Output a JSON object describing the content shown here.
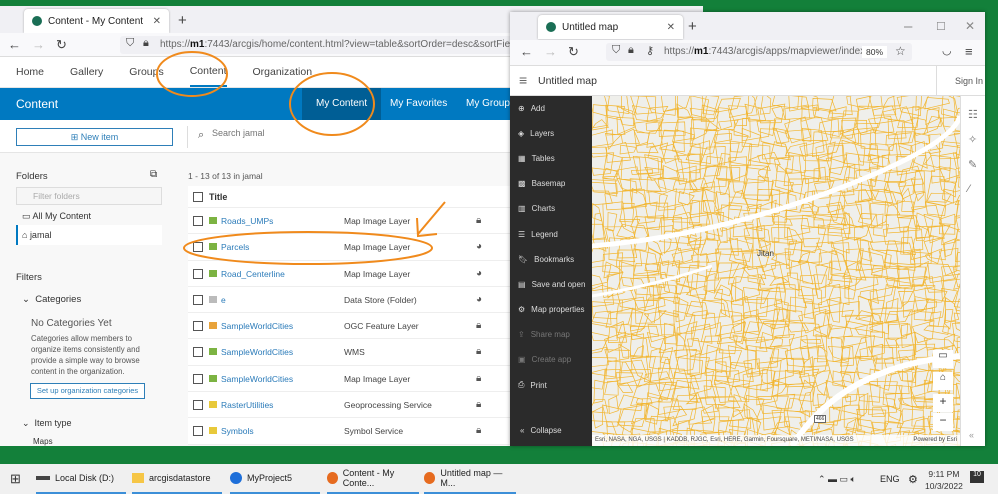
{
  "left_browser": {
    "tab_title": "Content - My Content",
    "url_prefix": "https://",
    "url_host": "m1",
    "url_rest": ":7443/arcgis/home/content.html?view=table&sortOrder=desc&sortField=mo",
    "nav": [
      "Home",
      "Gallery",
      "Groups",
      "Content",
      "Organization"
    ],
    "header_title": "Content",
    "subtabs": [
      "My Content",
      "My Favorites",
      "My Groups"
    ],
    "new_item": "New item",
    "search_placeholder": "Search jamal",
    "folders_label": "Folders",
    "filter_placeholder": "Filter folders",
    "folders": [
      "All My Content",
      "jamal"
    ],
    "filters_label": "Filters",
    "categories_label": "Categories",
    "no_categories": "No Categories Yet",
    "categories_desc": "Categories allow members to organize items consistently and provide a simple way to browse content in the organization.",
    "setup_button": "Set up organization categories",
    "item_type_label": "Item type",
    "item_type_first": "Maps",
    "count": "1 - 13 of 13 in jamal",
    "col_title": "Title",
    "rows": [
      {
        "title": "Roads_UMPs",
        "type": "Map Image Layer",
        "share": "private"
      },
      {
        "title": "Parcels",
        "type": "Map Image Layer",
        "share": "public"
      },
      {
        "title": "Road_Centerline",
        "type": "Map Image Layer",
        "share": "public"
      },
      {
        "title": "e",
        "type": "Data Store (Folder)",
        "share": "public"
      },
      {
        "title": "SampleWorldCities",
        "type": "OGC Feature Layer",
        "share": "private"
      },
      {
        "title": "SampleWorldCities",
        "type": "WMS",
        "share": "private"
      },
      {
        "title": "SampleWorldCities",
        "type": "Map Image Layer",
        "share": "private"
      },
      {
        "title": "RasterUtilities",
        "type": "Geoprocessing Service",
        "share": "private"
      },
      {
        "title": "Symbols",
        "type": "Symbol Service",
        "share": "private"
      }
    ]
  },
  "right_browser": {
    "tab_title": "Untitled map",
    "url_prefix": "https://",
    "url_host": "m1",
    "url_rest": ":7443/arcgis/apps/mapviewer/index.ht",
    "zoom": "80%",
    "app_title": "Untitled map",
    "sign_in": "Sign In",
    "sidebar": [
      {
        "label": "Add",
        "icon": "plus-circle"
      },
      {
        "label": "Layers",
        "icon": "layers"
      },
      {
        "label": "Tables",
        "icon": "table"
      },
      {
        "label": "Basemap",
        "icon": "basemap"
      },
      {
        "label": "Charts",
        "icon": "chart"
      },
      {
        "label": "Legend",
        "icon": "legend"
      },
      {
        "label": "Bookmarks",
        "icon": "bookmark"
      },
      {
        "label": "Save and open",
        "icon": "save"
      },
      {
        "label": "Map properties",
        "icon": "settings"
      },
      {
        "label": "Share map",
        "icon": "share",
        "disabled": true
      },
      {
        "label": "Create app",
        "icon": "app",
        "disabled": true
      },
      {
        "label": "Print",
        "icon": "print"
      }
    ],
    "collapse": "Collapse",
    "place_label": "Jitan",
    "road_shield": "466",
    "attribution": "Esri, NASA, NGA, USGS | KADDB, RJGC, Esri, HERE, Garmin, Foursquare, METI/NASA, USGS",
    "powered": "Powered by Esri"
  },
  "taskbar": {
    "items": [
      "Local Disk (D:)",
      "arcgisdatastore",
      "MyProject5",
      "Content - My Conte...",
      "Untitled map — M..."
    ],
    "lang": "ENG",
    "time": "9:11 PM",
    "date": "10/3/2022",
    "notifications": "10"
  },
  "colors": {
    "desktop": "#13803a",
    "esri_blue": "#0079c1",
    "annotation": "#f08a1c",
    "parcel": "#f2b631"
  }
}
